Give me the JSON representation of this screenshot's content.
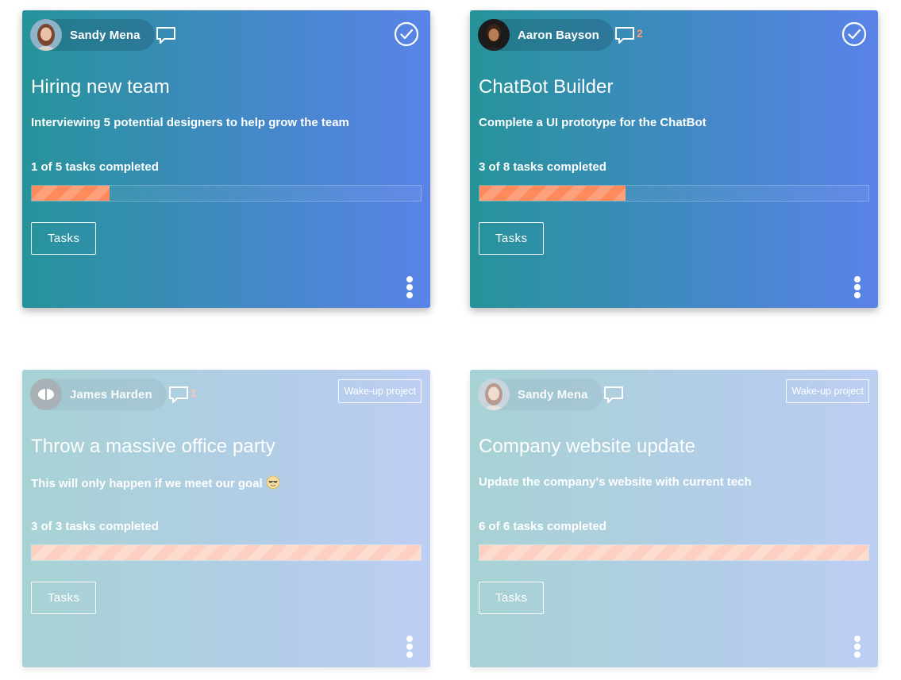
{
  "cards": [
    {
      "user": "Sandy Mena",
      "comment_count": "",
      "completed_icon": "check-circle-icon",
      "title": "Hiring new team",
      "description": "Interviewing 5 potential designers to help grow the team",
      "progress_text": "1 of 5 tasks completed",
      "progress_fraction": 0.2,
      "tasks_label": "Tasks"
    },
    {
      "user": "Aaron Bayson",
      "comment_count": "2",
      "completed_icon": "check-circle-icon",
      "title": "ChatBot Builder",
      "description": "Complete a UI prototype for the ChatBot",
      "progress_text": "3 of 8 tasks completed",
      "progress_fraction": 0.375,
      "tasks_label": "Tasks"
    },
    {
      "user": "James Harden",
      "comment_count": "1",
      "badge": "Wake-up project",
      "title": "Throw a massive office party",
      "description": "This will only happen if we meet our goal",
      "description_emoji": "sunglasses-emoji-icon",
      "progress_text": "3 of 3 tasks completed",
      "progress_fraction": 1.0,
      "tasks_label": "Tasks"
    },
    {
      "user": "Sandy Mena",
      "comment_count": "",
      "badge": "Wake-up project",
      "title": "Company website update",
      "description": "Update the company's website with current tech",
      "progress_text": "6 of 6 tasks completed",
      "progress_fraction": 1.0,
      "tasks_label": "Tasks"
    }
  ],
  "colors": {
    "card_gradient_start": "#26939a",
    "card_gradient_end": "#5a83e8",
    "faded_gradient_start": "#a7d2d4",
    "faded_gradient_end": "#bdcef3",
    "progress_fill": "#ff8a5c",
    "comment_count": "#ff9a70"
  }
}
